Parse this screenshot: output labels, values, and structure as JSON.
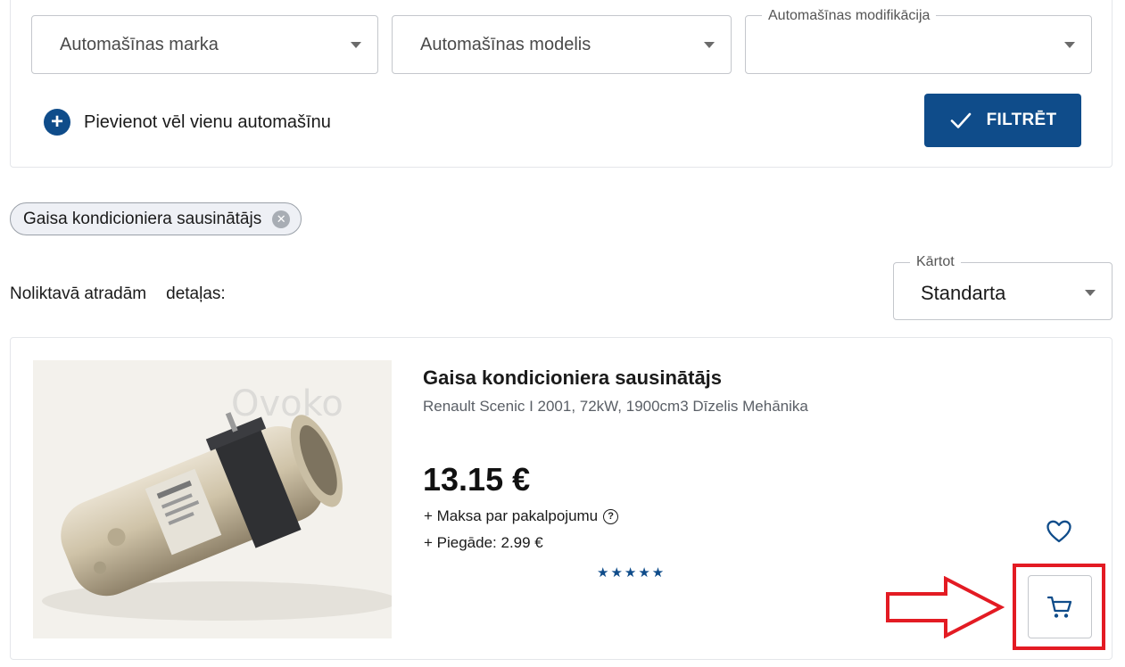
{
  "filters": {
    "make_placeholder": "Automašīnas marka",
    "model_placeholder": "Automašīnas modelis",
    "modification_label": "Automašīnas modifikācija",
    "modification_value": "",
    "add_car_label": "Pievienot vēl vienu automašīnu",
    "filter_button_label": "FILTRĒT",
    "colors": {
      "primary": "#0f4c8a"
    }
  },
  "active_chip": {
    "label": "Gaisa kondicioniera sausinātājs"
  },
  "results": {
    "found_prefix": "Noliktavā atradām",
    "found_suffix": "detaļas:"
  },
  "sort": {
    "label": "Kārtot",
    "value": "Standarta"
  },
  "product": {
    "watermark": "Ovoko",
    "title": "Gaisa kondicioniera sausinātājs",
    "subtitle": "Renault Scenic I 2001, 72kW, 1900cm3 Dīzelis Mehānika",
    "price": "13.15 €",
    "service_fee": "+ Maksa par pakalpojumu",
    "delivery": "+ Piegāde: 2.99 €",
    "rating_stars": "★★★★★",
    "rating": 5,
    "rating_max": 5
  },
  "annotation": {
    "highlight_color": "#e31b23"
  }
}
